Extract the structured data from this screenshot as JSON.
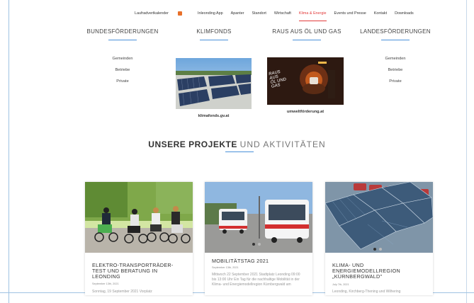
{
  "nav": {
    "items": [
      "Laufradvertkalender",
      "Inleonding App",
      "Apanter",
      "Standort",
      "Wirtschaft",
      "Klima & Energie",
      "Events und Presse",
      "Kontakt",
      "Downloads"
    ],
    "active_index": 5
  },
  "categories": [
    "BUNDESFÖRDERUNGEN",
    "KLIMFONDS",
    "RAUS AUS ÖL UND GAS",
    "LANDESFÖRDERUNGEN"
  ],
  "sublinks_left": [
    "Gemeinden",
    "Betriebe",
    "Private"
  ],
  "sublinks_right": [
    "Gemeinden",
    "Betriebe",
    "Private"
  ],
  "images": {
    "klimafonds_caption": "klimafonds.gv.at",
    "umwelt_caption": "umweltförderung.at",
    "poster_text_1": "RAUS AUS",
    "poster_text_2": "ÖL UND",
    "poster_text_3": "GAS"
  },
  "section": {
    "title_bold": "UNSERE PROJEKTE",
    "title_light": "UND AKTIVITÄTEN"
  },
  "cards": [
    {
      "title": "ELEKTRO-TRANSPORTRÄDER-TEST UND BERATUNG IN LEONDING",
      "date": "September 13th, 2021",
      "excerpt": "Sonntag, 19 September 2021 Vorplatz"
    },
    {
      "title": "MOBILITÄTSTAG 2021",
      "date": "September 13th, 2021",
      "excerpt": "Mittwoch 22 September 2021 Stadtplatz Leonding 09:00 bis 13:00 Uhr Ein Tag für die nachhaltige Mobilität in der Klima- und Energiemodellregion Kürnbergwald am"
    },
    {
      "title": "KLIMA- UND ENERGIEMODELLREGION „KÜRNBERGWALD\"",
      "date": "July 7th, 2021",
      "excerpt": "Leonding, Kirchberg-Thening und Wilhering"
    }
  ],
  "colors": {
    "accent": "#4a90d9",
    "active_nav": "#e23b3b"
  }
}
